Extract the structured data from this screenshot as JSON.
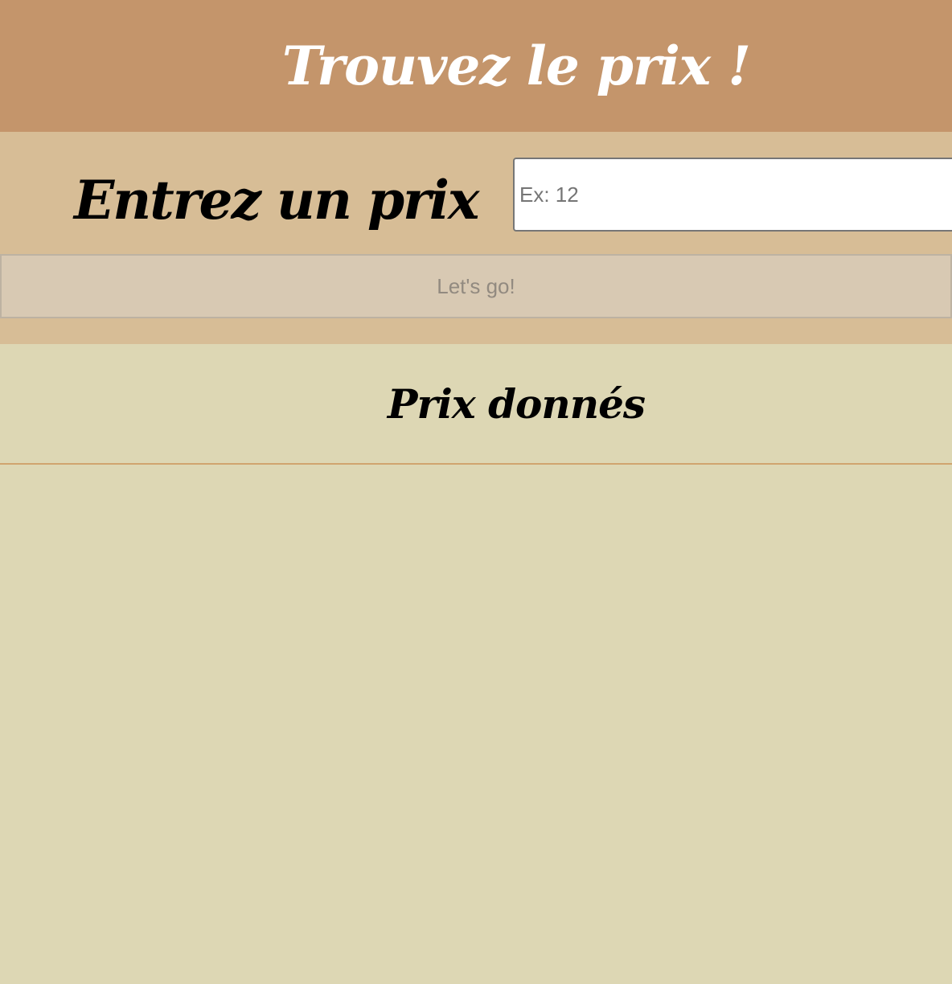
{
  "header": {
    "title": "Trouvez le prix !"
  },
  "form": {
    "label": "Entrez un prix",
    "input_placeholder": "Ex: 12",
    "input_value": "",
    "submit_label": "Let's go!"
  },
  "results": {
    "title": "Prix donnés",
    "items": []
  },
  "colors": {
    "header_bg": "#c4956b",
    "form_bg": "#d7bd96",
    "results_bg": "#ddd7b4",
    "divider": "#d0a46e"
  }
}
